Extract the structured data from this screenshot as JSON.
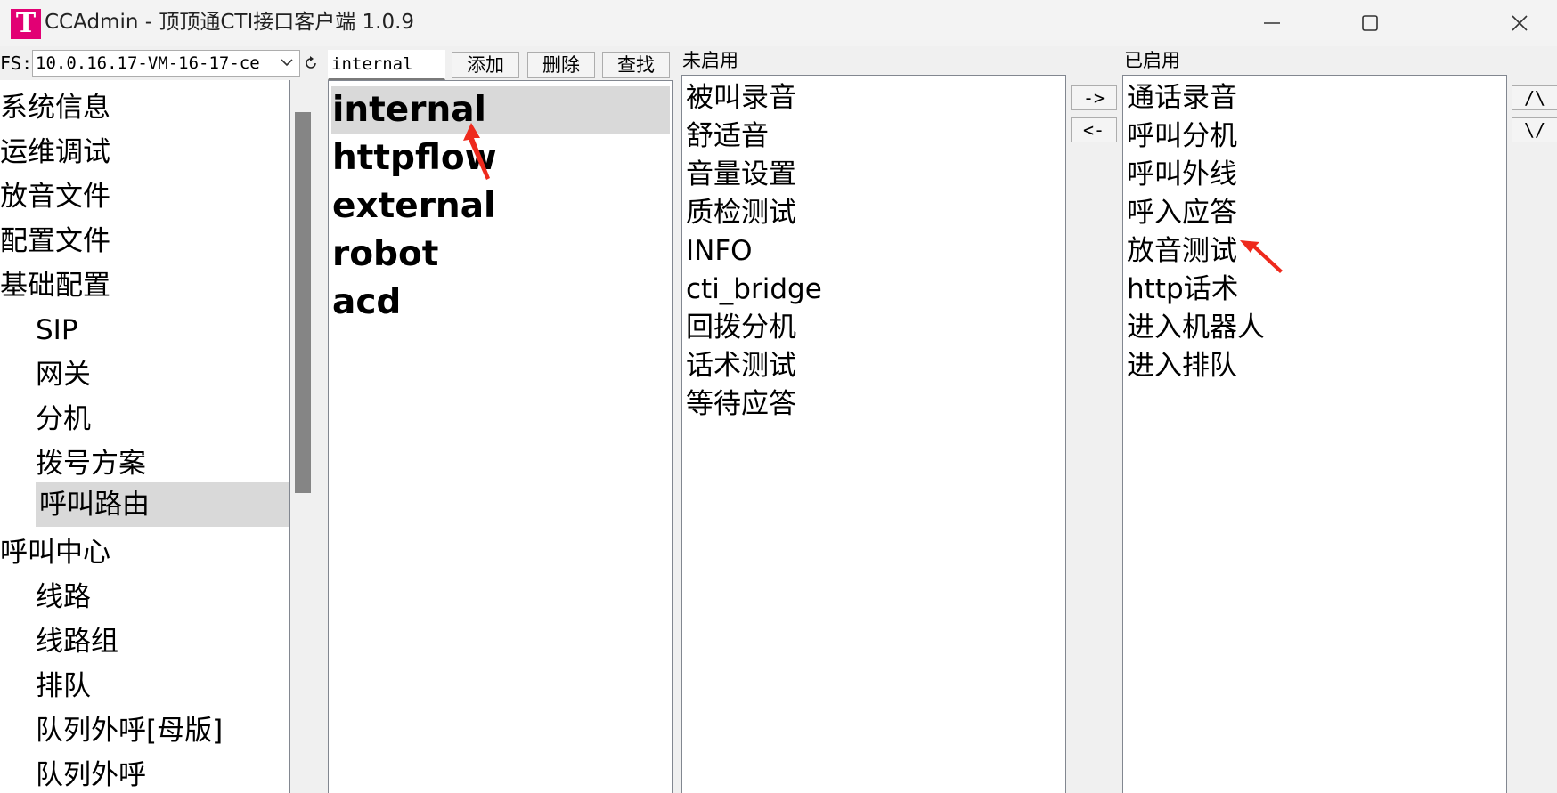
{
  "window": {
    "icon_letter": "T",
    "title": "CCAdmin - 顶顶通CTI接口客户端 1.0.9",
    "controls": [
      "minimize-icon",
      "maximize-icon",
      "close-icon"
    ],
    "brand_color": "#e20074"
  },
  "toolbar": {
    "fs_label": "FS:",
    "fs_value": "10.0.16.17-VM-16-17-ce",
    "name_value": "internal",
    "add_label": "添加",
    "delete_label": "删除",
    "search_label": "查找"
  },
  "nav": {
    "items": [
      {
        "label": "系统信息"
      },
      {
        "label": "运维调试"
      },
      {
        "label": "放音文件"
      },
      {
        "label": "配置文件"
      },
      {
        "label": "基础配置"
      },
      {
        "label": "SIP"
      },
      {
        "label": "网关"
      },
      {
        "label": "分机"
      },
      {
        "label": "拨号方案"
      },
      {
        "label": "呼叫路由",
        "selected": true
      },
      {
        "label": "呼叫中心"
      },
      {
        "label": "线路"
      },
      {
        "label": "线路组"
      },
      {
        "label": "排队"
      },
      {
        "label": "队列外呼[母版]"
      },
      {
        "label": "队列外呼"
      }
    ]
  },
  "routes": {
    "items": [
      "internal",
      "httpflow",
      "external",
      "robot",
      "acd"
    ],
    "selected": "internal"
  },
  "disabled": {
    "caption": "未启用",
    "items": [
      "被叫录音",
      "舒适音",
      "音量设置",
      "质检测试",
      "INFO",
      "cti_bridge",
      "回拨分机",
      "话术测试",
      "等待应答"
    ]
  },
  "enabled": {
    "caption": "已启用",
    "items": [
      "通话录音",
      "呼叫分机",
      "呼叫外线",
      "呼入应答",
      "放音测试",
      "http话术",
      "进入机器人",
      "进入排队"
    ]
  },
  "transfer": {
    "move_right_label": "->",
    "move_left_label": "<-",
    "move_up_label": "/\\",
    "move_down_label": "\\/"
  },
  "annotation_color": "#ee2a1d"
}
